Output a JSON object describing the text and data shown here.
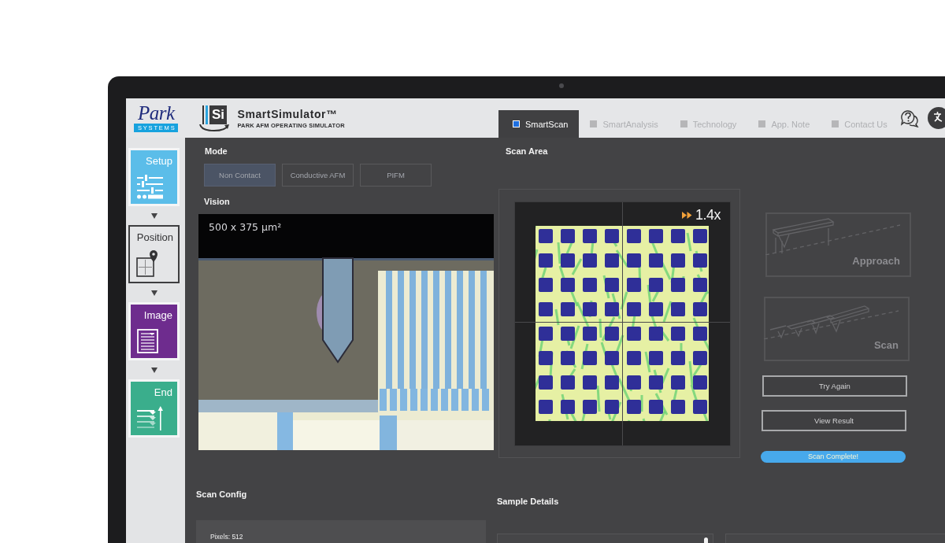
{
  "header": {
    "brand": {
      "name": "Park",
      "tagline": "SYSTEMS"
    },
    "product": {
      "mark": "Si",
      "title": "SmartSimulator™",
      "subtitle": "PARK AFM OPERATING SIMULATOR"
    },
    "tabs": [
      {
        "label": "SmartScan",
        "selected": true
      },
      {
        "label": "SmartAnalysis",
        "selected": false
      },
      {
        "label": "Technology",
        "selected": false
      },
      {
        "label": "App. Note",
        "selected": false
      },
      {
        "label": "Contact Us",
        "selected": false
      }
    ]
  },
  "sidebar": {
    "steps": [
      {
        "label": "Setup",
        "kind": "filled",
        "color": "#5bbde9"
      },
      {
        "label": "Position",
        "kind": "outlined",
        "color": "#e4e5e7"
      },
      {
        "label": "Image",
        "kind": "filled",
        "color": "#6e2c8e"
      },
      {
        "label": "End",
        "kind": "filled",
        "color": "#3aae8c"
      }
    ]
  },
  "mode": {
    "label": "Mode",
    "options": [
      {
        "label": "Non Contact",
        "selected": true,
        "disabled": true
      },
      {
        "label": "Conductive AFM",
        "selected": false,
        "disabled": true
      },
      {
        "label": "PIFM",
        "selected": false,
        "disabled": true
      }
    ]
  },
  "vision": {
    "label": "Vision",
    "scale": "500 x 375 µm²"
  },
  "scan_area": {
    "label": "Scan Area",
    "zoom": "1.4x",
    "stages": [
      {
        "kind": "approach",
        "label": "Approach"
      },
      {
        "kind": "scan",
        "label": "Scan"
      }
    ],
    "actions": [
      {
        "label": "Try Again"
      },
      {
        "label": "View Result"
      }
    ],
    "status": "Scan Complete!"
  },
  "scan_config": {
    "label": "Scan Config",
    "pixels": "Pixels: 512"
  },
  "sample_details": {
    "label": "Sample Details"
  }
}
